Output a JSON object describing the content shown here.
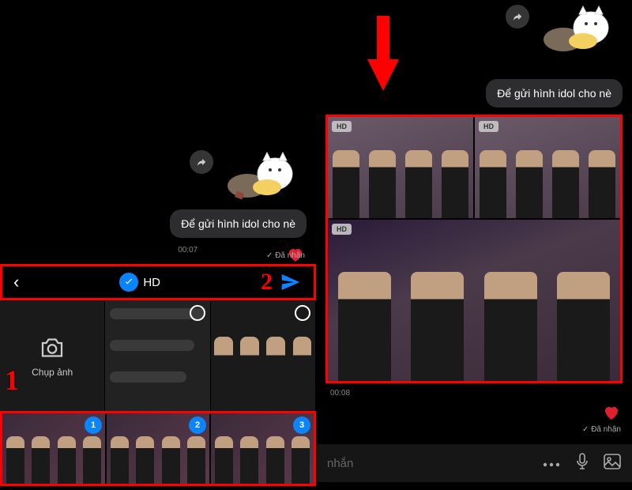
{
  "left": {
    "message": "Để gửi hình idol cho nè",
    "timestamp": "00:07",
    "status": "Đã nhận",
    "picker": {
      "hdLabel": "HD",
      "captureLabel": "Chụp ảnh"
    },
    "selected": [
      "1",
      "2",
      "3"
    ],
    "annotations": {
      "step1": "1",
      "step2": "2"
    }
  },
  "right": {
    "message": "Để gửi hình idol cho nè",
    "hdBadge": "HD",
    "timestamp": "00:08",
    "status": "Đã nhận",
    "inputPlaceholder": "nhắn"
  },
  "colors": {
    "accent": "#0a84ff",
    "highlight": "#ff0000"
  }
}
